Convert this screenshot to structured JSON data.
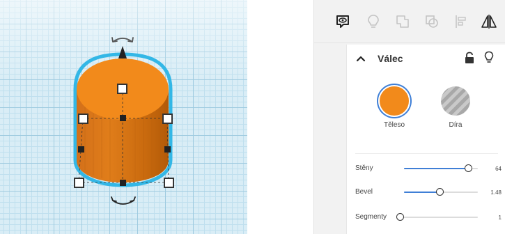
{
  "inspector": {
    "title": "Válec",
    "color_options": [
      {
        "label": "Těleso",
        "color": "#f28a1b",
        "selected": true
      },
      {
        "label": "Díra",
        "color": "#b5b5b5",
        "selected": false
      }
    ],
    "properties": [
      {
        "label": "Stěny",
        "value": "64",
        "level": 0.87
      },
      {
        "label": "Bevel",
        "value": "1.48",
        "level": 0.48
      },
      {
        "label": "Segmenty",
        "value": "1",
        "level": 0.0
      }
    ]
  },
  "toolbar": {
    "icons": [
      "note-eye-icon",
      "lightbulb-icon",
      "group-icon",
      "ungroup-icon",
      "align-icon",
      "mirror-icon"
    ]
  },
  "colors": {
    "object": "#f28a1b",
    "object_dark": "#c96a0e",
    "selection_outline": "#33b7e6",
    "accent": "#3f7fd6",
    "grid": "#d9edf6"
  }
}
